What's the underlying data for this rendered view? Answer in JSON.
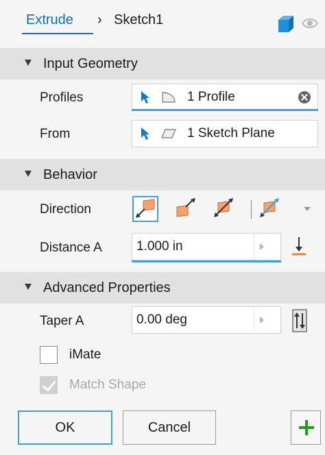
{
  "header": {
    "command": "Extrude",
    "separator": "›",
    "sketch": "Sketch1",
    "icons": [
      "cube-icon",
      "eye-icon"
    ]
  },
  "input_geometry": {
    "title": "Input Geometry",
    "profiles_label": "Profiles",
    "profiles_value": "1 Profile",
    "from_label": "From",
    "from_value": "1 Sketch Plane"
  },
  "behavior": {
    "title": "Behavior",
    "direction_label": "Direction",
    "direction_options": [
      "direction-default-icon",
      "direction-flipped-icon",
      "direction-symmetric-icon",
      "direction-asymmetric-icon"
    ],
    "selected_direction": "direction-default-icon",
    "distance_label": "Distance A",
    "distance_value": "1.000 in"
  },
  "advanced": {
    "title": "Advanced Properties",
    "taper_label": "Taper A",
    "taper_value": "0.00 deg",
    "imate_label": "iMate",
    "imate_checked": false,
    "match_shape_label": "Match Shape",
    "match_shape_checked": true
  },
  "footer": {
    "ok": "OK",
    "cancel": "Cancel"
  },
  "colors": {
    "accent": "#3fa1dc",
    "link": "#0a6fc2",
    "face": "#f4a36c",
    "plus": "#1b9e1b"
  }
}
